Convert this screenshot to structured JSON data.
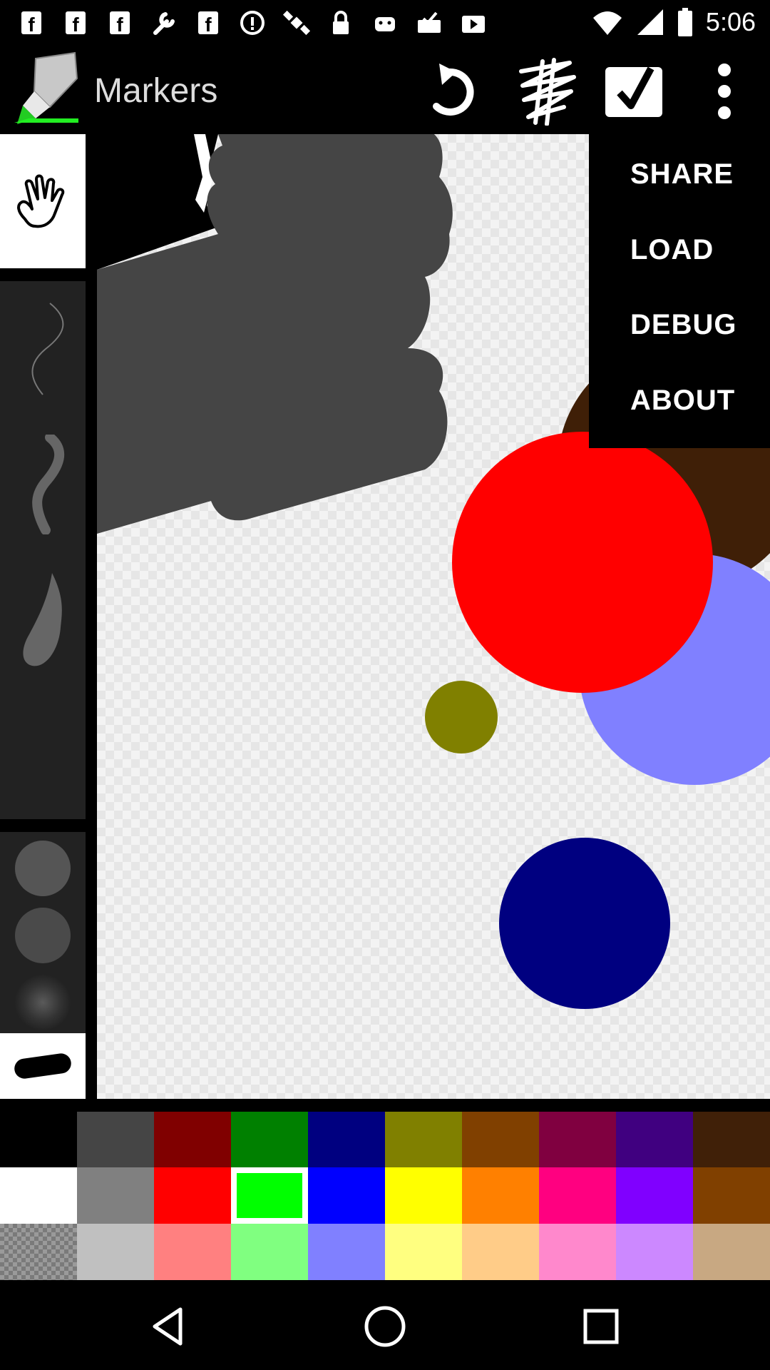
{
  "status_bar": {
    "time": "5:06",
    "icons": [
      "fb-icon",
      "fb-icon",
      "fb-icon",
      "wrench-icon",
      "fb-icon",
      "info-icon",
      "satellite-icon",
      "lock-icon",
      "android-icon",
      "download-done-icon",
      "play-store-icon",
      "wifi-icon",
      "signal-icon",
      "battery-icon"
    ]
  },
  "app_bar": {
    "title": "Markers",
    "actions": [
      "undo-icon",
      "scribble-icon",
      "check-icon",
      "more-vert-icon"
    ]
  },
  "tools": {
    "brush_size": "168"
  },
  "menu": {
    "items": [
      "SHARE",
      "LOAD",
      "DEBUG",
      "ABOUT"
    ]
  },
  "canvas_colors": {
    "gray_shape": "#454545",
    "brown_circle": "#3f1f07",
    "lavender_circle": "#8080ff",
    "red_circle": "#ff0000",
    "olive_circle": "#808000",
    "navy_circle": "#000080"
  },
  "palette": {
    "rows": [
      [
        "#000000",
        "#454545",
        "#800000",
        "#008000",
        "#000080",
        "#808000",
        "#804000",
        "#800040",
        "#400080",
        "#402008"
      ],
      [
        "#ffffff",
        "#808080",
        "#ff0000",
        "#00ff00",
        "#0000ff",
        "#ffff00",
        "#ff8000",
        "#ff0080",
        "#8000ff",
        "#804000"
      ],
      [
        "checker",
        "#c0c0c0",
        "#ff8080",
        "#80ff80",
        "#8080ff",
        "#ffff80",
        "#ffcc88",
        "#ff88cc",
        "#cc88ff",
        "#c8a882"
      ]
    ],
    "selected": "#00ff00"
  },
  "nav_bar": [
    "back-icon",
    "home-icon",
    "recents-icon"
  ]
}
